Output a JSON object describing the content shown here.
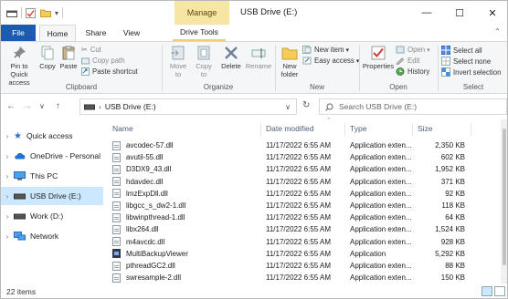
{
  "titlebar": {
    "context_tab": "Manage",
    "title": "USB Drive (E:)",
    "minimize": "—",
    "maximize": "☐",
    "close": "✕"
  },
  "tabs": {
    "file": "File",
    "home": "Home",
    "share": "Share",
    "view": "View",
    "drive_tools": "Drive Tools"
  },
  "ribbon": {
    "clipboard": {
      "label": "Clipboard",
      "pin": "Pin to Quick access",
      "copy": "Copy",
      "paste": "Paste",
      "cut": "Cut",
      "copy_path": "Copy path",
      "paste_shortcut": "Paste shortcut"
    },
    "organize": {
      "label": "Organize",
      "move_to": "Move to",
      "copy_to": "Copy to",
      "delete": "Delete",
      "rename": "Rename"
    },
    "new": {
      "label": "New",
      "new_folder": "New folder",
      "new_item": "New item",
      "easy_access": "Easy access"
    },
    "open": {
      "label": "Open",
      "properties": "Properties",
      "open": "Open",
      "edit": "Edit",
      "history": "History"
    },
    "select": {
      "label": "Select",
      "select_all": "Select all",
      "select_none": "Select none",
      "invert": "Invert selection"
    }
  },
  "address": {
    "path_root": "›",
    "path_location": "USB Drive (E:)",
    "search_placeholder": "Search USB Drive (E:)"
  },
  "nav": {
    "items": [
      {
        "label": "Quick access"
      },
      {
        "label": "OneDrive - Personal"
      },
      {
        "label": "This PC"
      },
      {
        "label": "USB Drive (E:)"
      },
      {
        "label": "Work (D:)"
      },
      {
        "label": "Network"
      }
    ]
  },
  "columns": {
    "name": "Name",
    "date": "Date modified",
    "type": "Type",
    "size": "Size"
  },
  "files": [
    {
      "name": "avcodec-57.dll",
      "date": "11/17/2022 6:55 AM",
      "type": "Application exten...",
      "size": "2,350 KB",
      "icon": "dll"
    },
    {
      "name": "avutil-55.dll",
      "date": "11/17/2022 6:55 AM",
      "type": "Application exten...",
      "size": "602 KB",
      "icon": "dll"
    },
    {
      "name": "D3DX9_43.dll",
      "date": "11/17/2022 6:55 AM",
      "type": "Application exten...",
      "size": "1,952 KB",
      "icon": "dll"
    },
    {
      "name": "hdavdec.dll",
      "date": "11/17/2022 6:55 AM",
      "type": "Application exten...",
      "size": "371 KB",
      "icon": "dll"
    },
    {
      "name": "lmzExpDll.dll",
      "date": "11/17/2022 6:55 AM",
      "type": "Application exten...",
      "size": "92 KB",
      "icon": "dll"
    },
    {
      "name": "libgcc_s_dw2-1.dll",
      "date": "11/17/2022 6:55 AM",
      "type": "Application exten...",
      "size": "118 KB",
      "icon": "dll"
    },
    {
      "name": "libwinpthread-1.dll",
      "date": "11/17/2022 6:55 AM",
      "type": "Application exten...",
      "size": "64 KB",
      "icon": "dll"
    },
    {
      "name": "libx264.dll",
      "date": "11/17/2022 6:55 AM",
      "type": "Application exten...",
      "size": "1,524 KB",
      "icon": "dll"
    },
    {
      "name": "m4avcdc.dll",
      "date": "11/17/2022 6:55 AM",
      "type": "Application exten...",
      "size": "928 KB",
      "icon": "dll"
    },
    {
      "name": "MultiBackupViewer",
      "date": "11/17/2022 6:55 AM",
      "type": "Application",
      "size": "5,292 KB",
      "icon": "app"
    },
    {
      "name": "pthreadGC2.dll",
      "date": "11/17/2022 6:55 AM",
      "type": "Application exten...",
      "size": "88 KB",
      "icon": "dll"
    },
    {
      "name": "swresample-2.dll",
      "date": "11/17/2022 6:55 AM",
      "type": "Application exten...",
      "size": "150 KB",
      "icon": "dll"
    }
  ],
  "status": {
    "count": "22 items"
  },
  "colors": {
    "file_tab": "#1e5ab0",
    "manage_tab": "#f6e6a4",
    "selected_nav": "#cce8ff"
  }
}
